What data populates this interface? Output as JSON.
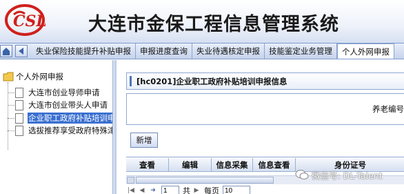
{
  "header": {
    "logo_text": "CSL",
    "title": "大连市金保工程信息管理系统"
  },
  "nav": {
    "home_icon": "home-icon",
    "back_icon": "back-arrow-icon",
    "tabs": [
      {
        "label": "失业保险技能提升补贴申报"
      },
      {
        "label": "申报进度查询"
      },
      {
        "label": "失业待遇核定申报"
      },
      {
        "label": "技能鉴定业务管理"
      },
      {
        "label": "个人外网申报",
        "active": true
      }
    ]
  },
  "tree": {
    "root_label": "个人外网申报",
    "items": [
      {
        "label": "大连市创业导师申请"
      },
      {
        "label": "大连市创业带头人申请"
      },
      {
        "label": "企业职工政府补贴培训申报",
        "selected": true
      },
      {
        "label": "选拔推荐享受政府特殊津贴"
      }
    ]
  },
  "main": {
    "panel_title": "[hc0201]企业职工政府补贴培训申报信息",
    "pension_label": "养老编号",
    "add_button": "新增",
    "grid_columns": [
      "查看",
      "编辑",
      "信息采集",
      "信息查看",
      "身份证号"
    ],
    "pager": {
      "page_value": "1",
      "page_suffix": "共",
      "per_page_label": "每页",
      "per_page_value": "10"
    }
  },
  "watermark": {
    "text": "微信号: DL-Talent"
  },
  "colors": {
    "accent": "#3a6fd0",
    "logo_red": "#d0201c",
    "nav_border": "#7f9dcf"
  }
}
